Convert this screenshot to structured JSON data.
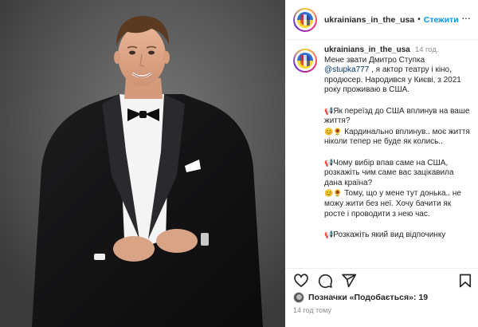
{
  "header": {
    "username": "ukrainians_in_the_usa",
    "separator": "•",
    "follow_label": "Стежити",
    "more_label": "···"
  },
  "caption": {
    "username": "ukrainians_in_the_usa",
    "time": "14 год.",
    "intro_part1": "Мене звати Дмитро Ступка",
    "mention": "@stupka777",
    "intro_part2": ", я актор театру і кіно, продюсер. Народився у Києві, з 2021 року проживаю в США.",
    "q1_mark": "📢",
    "q1": "Як переїзд до США вплинув на ваше життя?",
    "a1_mark": "😊🌻",
    "a1": "Кардинально вплинув.. моє життя ніколи тепер не буде як колись..",
    "q2_mark": "📢",
    "q2": "Чому вибір впав саме на США, розкажіть чим саме вас зацікавила дана країна?",
    "a2_mark": "😊🌻",
    "a2": "Тому, що у мене тут донька.. не можу жити без неї. Хочу бачити як росте і проводити з нею час.",
    "q3_mark": "📢",
    "q3": "Розкажіть який вид відпочинку"
  },
  "actions": {
    "icons": [
      "heart-icon",
      "comment-icon",
      "share-icon",
      "bookmark-icon"
    ]
  },
  "likes": {
    "prefix": "Позначки «Подобається»:",
    "count": "19"
  },
  "post_time": "14 год тому",
  "colors": {
    "link": "#0095f6",
    "mention": "#00376b",
    "muted": "#8e8e8e",
    "text": "#262626"
  }
}
